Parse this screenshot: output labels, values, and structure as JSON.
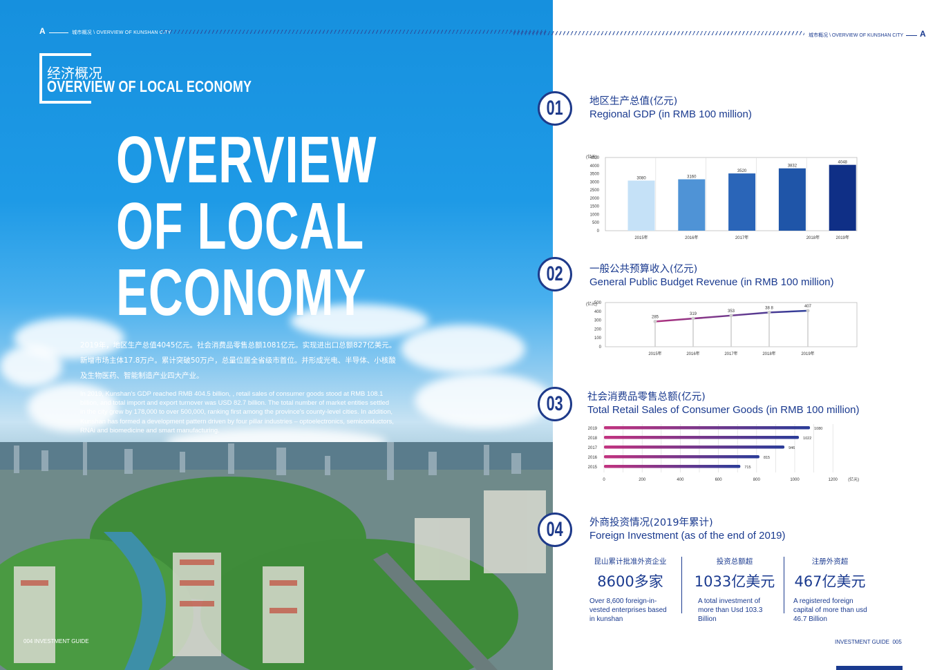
{
  "left": {
    "running_head": {
      "letter": "A",
      "cn": "城市概况",
      "en": "OVERVIEW OF KUNSHAN CITY"
    },
    "section_title_cn": "经济概况",
    "section_title_en": "OVERVIEW OF LOCAL ECONOMY",
    "big_title": [
      "OVERVIEW",
      "OF LOCAL",
      "ECONOMY"
    ],
    "para_cn": "2019年，地区生产总值4045亿元。社会消费品零售总额1081亿元。实现进出口总额827亿美元。新增市场主体17.8万户。累计突破50万户，总量位居全省级市首位。并形成光电、半导体、小核酸及生物医药、智能制造产业四大产业。",
    "para_en": "In 2019, Kunshan's GDP reached RMB 404.5 billion, , retail sales of consumer goods stood at RMB 108.1 billion, and total import and export turnover was USD 82.7 billion. The total number of market entities settled in the city grew by 178,000 to over 500,000, ranking first among the province's county-level cities. In addition, Kunshan has formed a development pattern driven by four pillar industries – optoelectronics, semiconductors, RNAi and biomedicine and smart manufacturing.",
    "footer": "004  INVESTMENT GUIDE"
  },
  "right": {
    "running_head": {
      "cn": "城市概况",
      "en": "OVERVIEW OF KUNSHAN CITY",
      "letter": "A"
    },
    "sections": [
      {
        "num": "01",
        "cn": "地区生产总值(亿元)",
        "en": "Regional GDP (in RMB 100 million)"
      },
      {
        "num": "02",
        "cn": "一般公共预算收入(亿元)",
        "en": "General Public Budget Revenue (in RMB 100 million)"
      },
      {
        "num": "03",
        "cn": "社会消费品零售总额(亿元)",
        "en": "Total Retail Sales of Consumer Goods (in RMB 100 million)"
      },
      {
        "num": "04",
        "cn": "外商投资情况(2019年累计)",
        "en": "Foreign Investment (as of the end of 2019)"
      }
    ],
    "foreign_investment": [
      {
        "head": "昆山累计批准外资企业",
        "big": "8600多家",
        "desc": "Over 8,600 foreign-in-vested enterprises based in kunshan"
      },
      {
        "head": "投资总额超",
        "big": "1033亿美元",
        "desc": "A total investment of more than Usd 103.3 Billion"
      },
      {
        "head": "注册外资超",
        "big": "467亿美元",
        "desc": "A registered foreign capital of more than usd 46.7 Billion"
      }
    ],
    "footer": {
      "label": "INVESTMENT GUIDE",
      "page": "005"
    }
  },
  "chart_data": [
    {
      "type": "bar",
      "ylabel": "(亿元)",
      "ylim": [
        0,
        4500
      ],
      "yticks": [
        0,
        500,
        1000,
        1500,
        2000,
        2500,
        3000,
        3500,
        4000,
        4500
      ],
      "categories": [
        "2015年",
        "2016年",
        "2017年",
        "2018年",
        "2019年"
      ],
      "values": [
        3080,
        3160,
        3520,
        3832,
        4048
      ],
      "value_labels": [
        "3080",
        "3160",
        "3520",
        "3832",
        "4048"
      ],
      "colors": [
        "#c5e1f7",
        "#4f93d6",
        "#2a65b8",
        "#1f55a8",
        "#0f2f86"
      ],
      "grid": true
    },
    {
      "type": "line",
      "ylabel": "(亿元)",
      "ylim": [
        0,
        500
      ],
      "yticks": [
        0,
        100,
        200,
        300,
        400,
        500
      ],
      "categories": [
        "2015年",
        "2016年",
        "2017年",
        "2018年",
        "2019年"
      ],
      "values": [
        285,
        319,
        353,
        388,
        407
      ],
      "value_labels": [
        "285",
        "319",
        "353",
        "38 8",
        "407"
      ],
      "grid": true
    },
    {
      "type": "bar",
      "orientation": "horizontal",
      "xlabel": "(亿元)",
      "xlim": [
        0,
        1200
      ],
      "xticks": [
        0,
        200,
        400,
        600,
        800,
        1000,
        1200
      ],
      "categories": [
        "2019",
        "2018",
        "2017",
        "2016",
        "2015"
      ],
      "values": [
        1080,
        1022,
        946,
        815,
        715
      ],
      "value_labels": [
        "1080",
        "1022",
        "946",
        "815",
        "715"
      ],
      "grid": true
    }
  ]
}
